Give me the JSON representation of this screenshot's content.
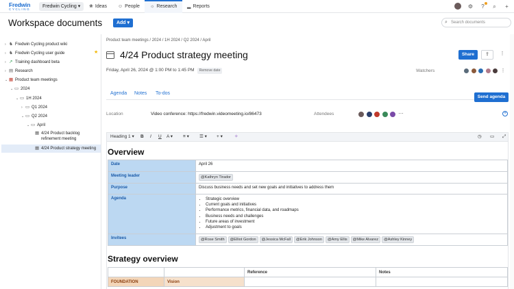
{
  "app": {
    "logo_line1": "Fredwin",
    "logo_line2": "CYCLING",
    "workspace": "Fredwin Cycling ▾",
    "nav": [
      {
        "label": "Ideas",
        "icon": "❀"
      },
      {
        "label": "People",
        "icon": "☺"
      },
      {
        "label": "Research",
        "icon": "☼"
      },
      {
        "label": "Reports",
        "icon": "▂"
      }
    ],
    "search_placeholder": "Search documents"
  },
  "page": {
    "title": "Workspace documents",
    "add_label": "Add ▾"
  },
  "sidebar": {
    "items": [
      {
        "label": "Fredwin Cycling product wiki",
        "chev": "›",
        "icon": "♞"
      },
      {
        "label": "Fredwin Cycling user guide",
        "chev": "›",
        "icon": "♞"
      },
      {
        "label": "Training dashboard beta",
        "chev": "›",
        "icon": "↗"
      },
      {
        "label": "Research",
        "chev": "›",
        "icon": "▤"
      },
      {
        "label": "Product team meetings",
        "chev": "⌄",
        "icon": "▦"
      },
      {
        "label": "2024",
        "chev": "⌄",
        "icon": "▭"
      },
      {
        "label": "1H 2024",
        "chev": "⌄",
        "icon": "▭"
      },
      {
        "label": "Q1 2024",
        "chev": "›",
        "icon": "▭"
      },
      {
        "label": "Q2 2024",
        "chev": "⌄",
        "icon": "▭"
      },
      {
        "label": "April",
        "chev": "⌄",
        "icon": "▭"
      },
      {
        "label": "4/24 Product backlog",
        "label2": "refinement meeting",
        "icon": "▦"
      },
      {
        "label": "4/24 Product strategy meeting",
        "icon": "▦"
      }
    ]
  },
  "doc": {
    "breadcrumb": "Product team meetings  /  2024  /  1H 2024  /  Q2 2024  /  April",
    "title": "4/24 Product strategy meeting",
    "share_label": "Share",
    "date_text": "Friday, April 26, 2024 @ 1:00 PM to 1:45 PM",
    "remove_date": "Remove date",
    "watchers_label": "Watchers",
    "tabs": [
      "Agenda",
      "Notes",
      "To-dos"
    ],
    "send_agenda": "Send agenda",
    "location_label": "Location",
    "location_value": "Video conference: https://fredwin.videomeeting.io/86473",
    "attendees_label": "Attendees",
    "toolbar": {
      "heading": "Heading 1 ▾",
      "bold": "B",
      "italic": "I",
      "underline": "U",
      "font": "A ▾",
      "align": "≡ ▾",
      "list": "☰ ▾",
      "insert": "+ ▾"
    }
  },
  "overview": {
    "heading": "Overview",
    "date_label": "Date",
    "date_value": "April 26",
    "leader_label": "Meeting leader",
    "leader_value": "@Kathryn Tirador",
    "purpose_label": "Purpose",
    "purpose_value": "Discuss business needs and set new goals and initiatives to address them",
    "agenda_label": "Agenda",
    "agenda_items": [
      "Strategic overview",
      "Current goals and initiatives",
      "Performance metrics, financial data, and roadmaps",
      "Business needs and challenges",
      "Future areas of investment",
      "Adjustment to goals"
    ],
    "invitees_label": "Invitees",
    "invitees": [
      "@Rose Smith",
      "@Elliot Gordon",
      "@Jessica McFall",
      "@Erik Johnson",
      "@Amy Ellis",
      "@Mike Alvarez",
      "@Ashley Kinney"
    ]
  },
  "strategy": {
    "heading": "Strategy overview",
    "col_reference": "Reference",
    "col_notes": "Notes",
    "row_foundation": "FOUNDATION",
    "row_vision": "Vision"
  },
  "colors": {
    "accent": "#1f6fd1",
    "label_cell": "#bcd8f2",
    "foundation": "#f3d6b9"
  }
}
